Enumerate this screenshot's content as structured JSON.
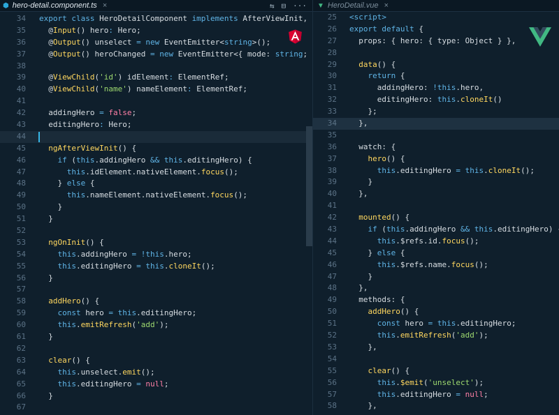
{
  "left": {
    "tab": {
      "icon": "typescript-file-icon",
      "title": "hero-detail.component.ts",
      "close": "×"
    },
    "actions": {
      "compare": "⇆",
      "split": "⊟",
      "more": "···"
    },
    "lines": [
      {
        "n": "34",
        "tokens": [
          [
            "k",
            "export "
          ],
          [
            "k",
            "class "
          ],
          [
            "t",
            "HeroDetailComponent "
          ],
          [
            "k",
            "implements "
          ],
          [
            "t",
            "AfterViewInit, OnIn"
          ]
        ]
      },
      {
        "n": "35",
        "tokens": [
          [
            "t",
            "  @"
          ],
          [
            "f",
            "Input"
          ],
          [
            "t",
            "() hero"
          ],
          [
            "k",
            ": "
          ],
          [
            "t",
            "Hero;"
          ]
        ]
      },
      {
        "n": "36",
        "tokens": [
          [
            "t",
            "  @"
          ],
          [
            "f",
            "Output"
          ],
          [
            "t",
            "() unselect "
          ],
          [
            "k",
            "= new "
          ],
          [
            "t",
            "EventEmitter<"
          ],
          [
            "k",
            "string"
          ],
          [
            "t",
            ">();"
          ]
        ]
      },
      {
        "n": "37",
        "tokens": [
          [
            "t",
            "  @"
          ],
          [
            "f",
            "Output"
          ],
          [
            "t",
            "() heroChanged "
          ],
          [
            "k",
            "= new "
          ],
          [
            "t",
            "EventEmitter<{ mode: "
          ],
          [
            "k",
            "string"
          ],
          [
            "t",
            "; hero"
          ]
        ]
      },
      {
        "n": "38",
        "tokens": []
      },
      {
        "n": "39",
        "tokens": [
          [
            "t",
            "  @"
          ],
          [
            "f",
            "ViewChild"
          ],
          [
            "t",
            "("
          ],
          [
            "s",
            "'id'"
          ],
          [
            "t",
            ") idElement"
          ],
          [
            "k",
            ": "
          ],
          [
            "t",
            "ElementRef;"
          ]
        ]
      },
      {
        "n": "40",
        "tokens": [
          [
            "t",
            "  @"
          ],
          [
            "f",
            "ViewChild"
          ],
          [
            "t",
            "("
          ],
          [
            "s",
            "'name'"
          ],
          [
            "t",
            ") nameElement"
          ],
          [
            "k",
            ": "
          ],
          [
            "t",
            "ElementRef;"
          ]
        ]
      },
      {
        "n": "41",
        "tokens": []
      },
      {
        "n": "42",
        "tokens": [
          [
            "t",
            "  addingHero "
          ],
          [
            "k",
            "= "
          ],
          [
            "c",
            "false"
          ],
          [
            "t",
            ";"
          ]
        ]
      },
      {
        "n": "43",
        "tokens": [
          [
            "t",
            "  editingHero"
          ],
          [
            "k",
            ": "
          ],
          [
            "t",
            "Hero;"
          ]
        ]
      },
      {
        "n": "44",
        "tokens": []
      },
      {
        "n": "45",
        "tokens": [
          [
            "t",
            "  "
          ],
          [
            "f",
            "ngAfterViewInit"
          ],
          [
            "t",
            "() {"
          ]
        ]
      },
      {
        "n": "46",
        "tokens": [
          [
            "t",
            "    "
          ],
          [
            "k",
            "if "
          ],
          [
            "t",
            "("
          ],
          [
            "k",
            "this"
          ],
          [
            "t",
            ".addingHero "
          ],
          [
            "k",
            "&& "
          ],
          [
            "k",
            "this"
          ],
          [
            "t",
            ".editingHero) {"
          ]
        ]
      },
      {
        "n": "47",
        "tokens": [
          [
            "t",
            "      "
          ],
          [
            "k",
            "this"
          ],
          [
            "t",
            ".idElement.nativeElement."
          ],
          [
            "f",
            "focus"
          ],
          [
            "t",
            "();"
          ]
        ]
      },
      {
        "n": "48",
        "tokens": [
          [
            "t",
            "    } "
          ],
          [
            "k",
            "else "
          ],
          [
            "t",
            "{"
          ]
        ]
      },
      {
        "n": "49",
        "tokens": [
          [
            "t",
            "      "
          ],
          [
            "k",
            "this"
          ],
          [
            "t",
            ".nameElement.nativeElement."
          ],
          [
            "f",
            "focus"
          ],
          [
            "t",
            "();"
          ]
        ]
      },
      {
        "n": "50",
        "tokens": [
          [
            "t",
            "    }"
          ]
        ]
      },
      {
        "n": "51",
        "tokens": [
          [
            "t",
            "  }"
          ]
        ]
      },
      {
        "n": "52",
        "tokens": []
      },
      {
        "n": "53",
        "tokens": [
          [
            "t",
            "  "
          ],
          [
            "f",
            "ngOnInit"
          ],
          [
            "t",
            "() {"
          ]
        ]
      },
      {
        "n": "54",
        "tokens": [
          [
            "t",
            "    "
          ],
          [
            "k",
            "this"
          ],
          [
            "t",
            ".addingHero "
          ],
          [
            "k",
            "= !"
          ],
          [
            "k",
            "this"
          ],
          [
            "t",
            ".hero;"
          ]
        ]
      },
      {
        "n": "55",
        "tokens": [
          [
            "t",
            "    "
          ],
          [
            "k",
            "this"
          ],
          [
            "t",
            ".editingHero "
          ],
          [
            "k",
            "= "
          ],
          [
            "k",
            "this"
          ],
          [
            "t",
            "."
          ],
          [
            "f",
            "cloneIt"
          ],
          [
            "t",
            "();"
          ]
        ]
      },
      {
        "n": "56",
        "tokens": [
          [
            "t",
            "  }"
          ]
        ]
      },
      {
        "n": "57",
        "tokens": []
      },
      {
        "n": "58",
        "tokens": [
          [
            "t",
            "  "
          ],
          [
            "f",
            "addHero"
          ],
          [
            "t",
            "() {"
          ]
        ]
      },
      {
        "n": "59",
        "tokens": [
          [
            "t",
            "    "
          ],
          [
            "k",
            "const "
          ],
          [
            "t",
            "hero "
          ],
          [
            "k",
            "= "
          ],
          [
            "k",
            "this"
          ],
          [
            "t",
            ".editingHero;"
          ]
        ]
      },
      {
        "n": "60",
        "tokens": [
          [
            "t",
            "    "
          ],
          [
            "k",
            "this"
          ],
          [
            "t",
            "."
          ],
          [
            "f",
            "emitRefresh"
          ],
          [
            "t",
            "("
          ],
          [
            "s",
            "'add'"
          ],
          [
            "t",
            ");"
          ]
        ]
      },
      {
        "n": "61",
        "tokens": [
          [
            "t",
            "  }"
          ]
        ]
      },
      {
        "n": "62",
        "tokens": []
      },
      {
        "n": "63",
        "tokens": [
          [
            "t",
            "  "
          ],
          [
            "f",
            "clear"
          ],
          [
            "t",
            "() {"
          ]
        ]
      },
      {
        "n": "64",
        "tokens": [
          [
            "t",
            "    "
          ],
          [
            "k",
            "this"
          ],
          [
            "t",
            ".unselect."
          ],
          [
            "f",
            "emit"
          ],
          [
            "t",
            "();"
          ]
        ]
      },
      {
        "n": "65",
        "tokens": [
          [
            "t",
            "    "
          ],
          [
            "k",
            "this"
          ],
          [
            "t",
            ".editingHero "
          ],
          [
            "k",
            "= "
          ],
          [
            "c",
            "null"
          ],
          [
            "t",
            ";"
          ]
        ]
      },
      {
        "n": "66",
        "tokens": [
          [
            "t",
            "  }"
          ]
        ]
      },
      {
        "n": "67",
        "tokens": []
      }
    ]
  },
  "right": {
    "tab": {
      "icon": "vue-file-icon",
      "title": "HeroDetail.vue",
      "close": "×"
    },
    "lines": [
      {
        "n": "25",
        "tokens": [
          [
            "k",
            "<script>"
          ]
        ]
      },
      {
        "n": "26",
        "tokens": [
          [
            "k",
            "export default "
          ],
          [
            "t",
            "{"
          ]
        ]
      },
      {
        "n": "27",
        "tokens": [
          [
            "t",
            "  props: { hero: { type: Object } },"
          ]
        ]
      },
      {
        "n": "28",
        "tokens": []
      },
      {
        "n": "29",
        "tokens": [
          [
            "t",
            "  "
          ],
          [
            "f",
            "data"
          ],
          [
            "t",
            "() {"
          ]
        ]
      },
      {
        "n": "30",
        "tokens": [
          [
            "t",
            "    "
          ],
          [
            "k",
            "return "
          ],
          [
            "t",
            "{"
          ]
        ]
      },
      {
        "n": "31",
        "tokens": [
          [
            "t",
            "      addingHero: "
          ],
          [
            "k",
            "!"
          ],
          [
            "k",
            "this"
          ],
          [
            "t",
            ".hero,"
          ]
        ]
      },
      {
        "n": "32",
        "tokens": [
          [
            "t",
            "      editingHero: "
          ],
          [
            "k",
            "this"
          ],
          [
            "t",
            "."
          ],
          [
            "f",
            "cloneIt"
          ],
          [
            "t",
            "()"
          ]
        ]
      },
      {
        "n": "33",
        "tokens": [
          [
            "t",
            "    };"
          ]
        ]
      },
      {
        "n": "34",
        "tokens": [
          [
            "t",
            "  },"
          ]
        ]
      },
      {
        "n": "35",
        "tokens": []
      },
      {
        "n": "36",
        "tokens": [
          [
            "t",
            "  watch: {"
          ]
        ]
      },
      {
        "n": "37",
        "tokens": [
          [
            "t",
            "    "
          ],
          [
            "f",
            "hero"
          ],
          [
            "t",
            "() {"
          ]
        ]
      },
      {
        "n": "38",
        "tokens": [
          [
            "t",
            "      "
          ],
          [
            "k",
            "this"
          ],
          [
            "t",
            ".editingHero "
          ],
          [
            "k",
            "= "
          ],
          [
            "k",
            "this"
          ],
          [
            "t",
            "."
          ],
          [
            "f",
            "cloneIt"
          ],
          [
            "t",
            "();"
          ]
        ]
      },
      {
        "n": "39",
        "tokens": [
          [
            "t",
            "    }"
          ]
        ]
      },
      {
        "n": "40",
        "tokens": [
          [
            "t",
            "  },"
          ]
        ]
      },
      {
        "n": "41",
        "tokens": []
      },
      {
        "n": "42",
        "tokens": [
          [
            "t",
            "  "
          ],
          [
            "f",
            "mounted"
          ],
          [
            "t",
            "() {"
          ]
        ]
      },
      {
        "n": "43",
        "tokens": [
          [
            "t",
            "    "
          ],
          [
            "k",
            "if "
          ],
          [
            "t",
            "("
          ],
          [
            "k",
            "this"
          ],
          [
            "t",
            ".addingHero "
          ],
          [
            "k",
            "&& "
          ],
          [
            "k",
            "this"
          ],
          [
            "t",
            ".editingHero) {"
          ]
        ]
      },
      {
        "n": "44",
        "tokens": [
          [
            "t",
            "      "
          ],
          [
            "k",
            "this"
          ],
          [
            "t",
            ".$refs.id."
          ],
          [
            "f",
            "focus"
          ],
          [
            "t",
            "();"
          ]
        ]
      },
      {
        "n": "45",
        "tokens": [
          [
            "t",
            "    } "
          ],
          [
            "k",
            "else "
          ],
          [
            "t",
            "{"
          ]
        ]
      },
      {
        "n": "46",
        "tokens": [
          [
            "t",
            "      "
          ],
          [
            "k",
            "this"
          ],
          [
            "t",
            ".$refs.name."
          ],
          [
            "f",
            "focus"
          ],
          [
            "t",
            "();"
          ]
        ]
      },
      {
        "n": "47",
        "tokens": [
          [
            "t",
            "    }"
          ]
        ]
      },
      {
        "n": "48",
        "tokens": [
          [
            "t",
            "  },"
          ]
        ]
      },
      {
        "n": "49",
        "tokens": [
          [
            "t",
            "  methods: {"
          ]
        ]
      },
      {
        "n": "50",
        "tokens": [
          [
            "t",
            "    "
          ],
          [
            "f",
            "addHero"
          ],
          [
            "t",
            "() {"
          ]
        ]
      },
      {
        "n": "51",
        "tokens": [
          [
            "t",
            "      "
          ],
          [
            "k",
            "const "
          ],
          [
            "t",
            "hero "
          ],
          [
            "k",
            "= "
          ],
          [
            "k",
            "this"
          ],
          [
            "t",
            ".editingHero;"
          ]
        ]
      },
      {
        "n": "52",
        "tokens": [
          [
            "t",
            "      "
          ],
          [
            "k",
            "this"
          ],
          [
            "t",
            "."
          ],
          [
            "f",
            "emitRefresh"
          ],
          [
            "t",
            "("
          ],
          [
            "s",
            "'add'"
          ],
          [
            "t",
            ");"
          ]
        ]
      },
      {
        "n": "53",
        "tokens": [
          [
            "t",
            "    },"
          ]
        ]
      },
      {
        "n": "54",
        "tokens": []
      },
      {
        "n": "55",
        "tokens": [
          [
            "t",
            "    "
          ],
          [
            "f",
            "clear"
          ],
          [
            "t",
            "() {"
          ]
        ]
      },
      {
        "n": "56",
        "tokens": [
          [
            "t",
            "      "
          ],
          [
            "k",
            "this"
          ],
          [
            "t",
            "."
          ],
          [
            "f",
            "$emit"
          ],
          [
            "t",
            "("
          ],
          [
            "s",
            "'unselect'"
          ],
          [
            "t",
            ");"
          ]
        ]
      },
      {
        "n": "57",
        "tokens": [
          [
            "t",
            "      "
          ],
          [
            "k",
            "this"
          ],
          [
            "t",
            ".editingHero "
          ],
          [
            "k",
            "= "
          ],
          [
            "c",
            "null"
          ],
          [
            "t",
            ";"
          ]
        ]
      },
      {
        "n": "58",
        "tokens": [
          [
            "t",
            "    },"
          ]
        ]
      }
    ]
  },
  "state": {
    "left_cursor_line": "44",
    "right_highlight_line": "34"
  },
  "colors": {
    "background": "#0f1f2c",
    "keyword": "#5fb4e6",
    "function": "#ffd75f",
    "string": "#9dd86f",
    "literal": "#ff7fa6",
    "angular": "#dd0031",
    "vue_green": "#42b883",
    "vue_dark": "#35495e"
  }
}
